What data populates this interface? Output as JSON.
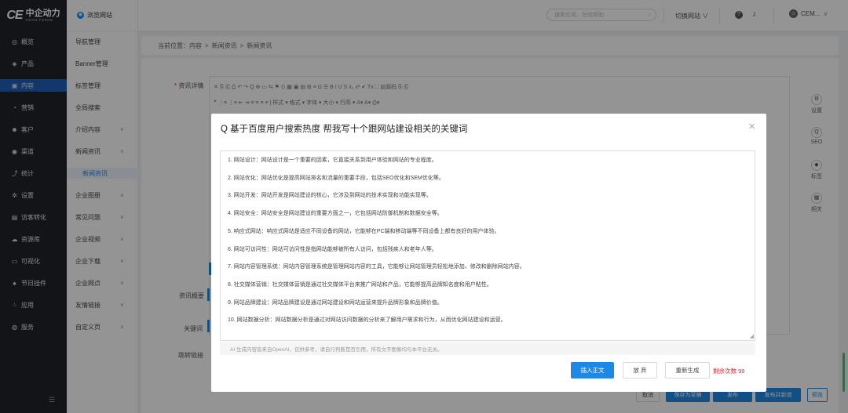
{
  "brand": {
    "mark": "CE",
    "name": "中企动力",
    "sub": "CEGN FORCE"
  },
  "nav1": [
    {
      "icon": "◎",
      "icon_name": "overview-icon",
      "label": "概览"
    },
    {
      "icon": "◈",
      "icon_name": "product-icon",
      "label": "产品"
    },
    {
      "icon": "▣",
      "icon_name": "content-icon",
      "label": "内容",
      "active": true
    },
    {
      "icon": "◔",
      "icon_name": "marketing-icon",
      "label": "营销"
    },
    {
      "icon": "☻",
      "icon_name": "customer-icon",
      "label": "客户"
    },
    {
      "icon": "◉",
      "icon_name": "channel-icon",
      "label": "渠道"
    },
    {
      "icon": "⤴",
      "icon_name": "stats-icon",
      "label": "统计"
    },
    {
      "icon": "✲",
      "icon_name": "settings-icon",
      "label": "设置"
    },
    {
      "icon": "▤",
      "icon_name": "visitor-icon",
      "label": "访客转化"
    },
    {
      "icon": "☁",
      "icon_name": "resource-icon",
      "label": "资源库"
    },
    {
      "icon": "▭",
      "icon_name": "visual-icon",
      "label": "可视化"
    },
    {
      "icon": "♠",
      "icon_name": "festival-icon",
      "label": "节日挂件"
    },
    {
      "icon": "⁘",
      "icon_name": "apps-icon",
      "label": "应用"
    },
    {
      "icon": "◍",
      "icon_name": "service-icon",
      "label": "服务"
    }
  ],
  "browse_label": "浏览网站",
  "nav2": [
    {
      "label": "导航管理",
      "chev": ""
    },
    {
      "label": "Banner管理",
      "chev": ""
    },
    {
      "label": "标签管理",
      "chev": ""
    },
    {
      "label": "全局搜索",
      "chev": ""
    },
    {
      "label": "介绍内容",
      "chev": "∨"
    },
    {
      "label": "新闻资讯",
      "chev": "∧"
    },
    {
      "label": "新闻资讯",
      "chev": "",
      "sub": true
    },
    {
      "label": "企业图册",
      "chev": "∨"
    },
    {
      "label": "常见问题",
      "chev": "∨"
    },
    {
      "label": "企业视频",
      "chev": "∨"
    },
    {
      "label": "企业下载",
      "chev": "∨"
    },
    {
      "label": "企业网点",
      "chev": "∨"
    },
    {
      "label": "友情链接",
      "chev": "∨"
    },
    {
      "label": "自定义页",
      "chev": "∨"
    }
  ],
  "topbar": {
    "search_placeholder": "搜索应用、在线帮助",
    "switch_label": "切换网站",
    "user_name": "CEM..."
  },
  "breadcrumb": [
    "当前位置：内容",
    ">",
    "新闻资讯",
    ">",
    "新闻资讯"
  ],
  "form": {
    "detail_label": "资讯详情",
    "summary_label": "资讯概要",
    "keyword_label": "关键词",
    "link_label": "跳转链接"
  },
  "right_tools": [
    {
      "icon": "⚙",
      "icon_name": "settings-icon",
      "label": "设置"
    },
    {
      "icon": "Q",
      "icon_name": "seo-icon",
      "label": "SEO"
    },
    {
      "icon": "◆",
      "icon_name": "tag-icon",
      "label": "标签"
    },
    {
      "icon": "▦",
      "icon_name": "related-icon",
      "label": "相关"
    }
  ],
  "editor_toolbar": {
    "row1": "✕  ⎘  ⎗  ⎙  ↶  ↷  Q  ⊕  ▭  ⇆  ⚑  ⟨⟩  ▦  ▣  ▤  ⊞  ≡  Ω  ☰  B  I  U  S  x₂  x²  ✔  Tx  ⛶  ▤源码  ⎘  ⎗",
    "row2": "❞  ⋮≡  ⋮≡  ⇤  ⇥  ≡  ≡  ≡  ≡  |  样式  ▾  格式  ▾  字体  ▾  大小  ▾  行高  ▾  A▾  A▾  ⎙▾"
  },
  "dialog": {
    "title": "Q 基于百度用户搜索热度 帮我写十个跟网站建设相关的关键词",
    "items": [
      "1. 网站设计：网站设计是一个重要的因素，它直接关系到用户体验和网站的专业程度。",
      "2. 网站优化：网站优化是提高网站排名和流量的重要手段，包括SEO优化和SEM优化等。",
      "3. 网站开发：网站开发是网站建设的核心，它涉及到网站的技术实现和功能实现等。",
      "4. 网站安全：网站安全是网站建设的重要方面之一，它包括网站防御机制和数据安全等。",
      "5. 响应式网站：响应式网站是适应不同设备的网站，它能够在PC端和移动端等不同设备上都有良好的用户体验。",
      "6. 网站可访问性：网站可访问性是指网站能够被所有人访问，包括残疾人和老年人等。",
      "7. 网站内容管理系统：网站内容管理系统是管理网站内容的工具，它能够让网站管理员轻松地添加、修改和删除网站内容。",
      "8. 社交媒体营销：社交媒体营销是通过社交媒体平台来推广网站和产品，它能够提高品牌知名度和用户粘性。",
      "9. 网站品牌建设：网站品牌建设是通过网站建设和网站运营来提升品牌形象和品牌价值。",
      "10. 网站数据分析：网站数据分析是通过对网站访问数据的分析来了解用户需求和行为，从而优化网站建设和运营。"
    ],
    "disclaimer": "AI 生成内容皆来自OpenAI，仅供参考，请自行判断是否引用，所有文字图像均与本平台无关。",
    "insert_label": "插入正文",
    "discard_label": "放 弃",
    "regen_label": "重新生成",
    "remaining_label": "剩余次数 99"
  },
  "footer_buttons": {
    "cancel": "取消",
    "save_draft": "保存为草稿",
    "publish": "发布",
    "publish_new": "发布并新增",
    "preview": "预览"
  },
  "colors": {
    "primary": "#1e88e5",
    "sidebar_dark": "#1f2329",
    "active_nav": "#1e5fb8",
    "danger": "#f5222d"
  }
}
